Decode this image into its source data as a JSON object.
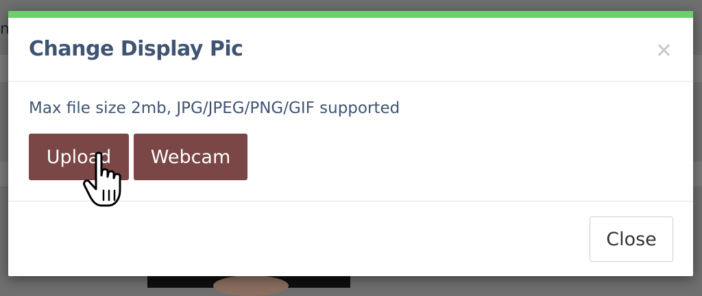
{
  "background": {
    "partial_letter": "n"
  },
  "modal": {
    "title": "Change Display Pic",
    "close_icon": "close-icon",
    "info_text": "Max file size 2mb, JPG/JPEG/PNG/GIF supported",
    "buttons": {
      "upload_label": "Upload",
      "webcam_label": "Webcam",
      "close_label": "Close"
    },
    "colors": {
      "accent": "#6ccf6c",
      "title": "#3f5473",
      "primary_button": "#7a4646"
    }
  },
  "cursor": {
    "icon": "hand-pointer-icon"
  }
}
